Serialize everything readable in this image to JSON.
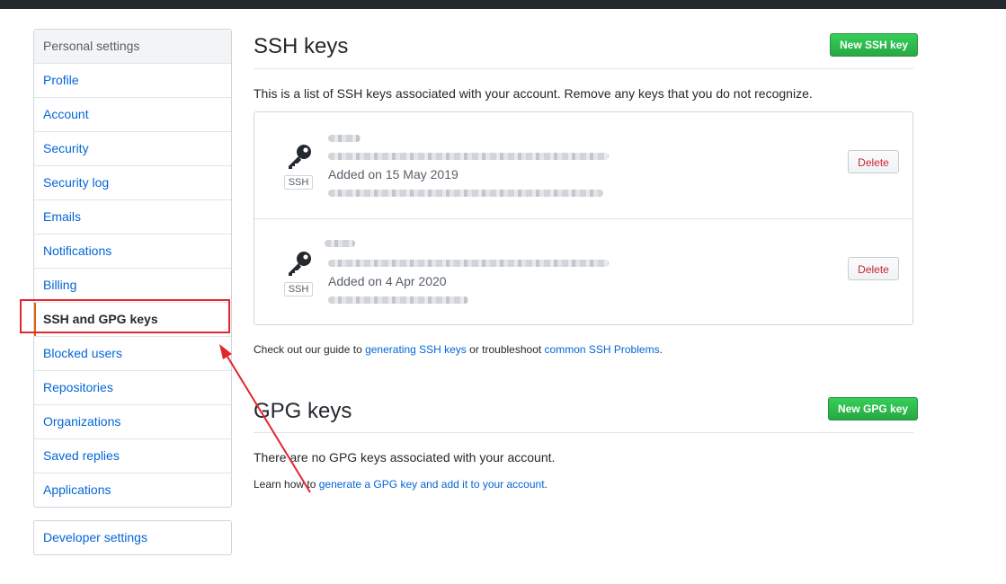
{
  "sidebar": {
    "heading": "Personal settings",
    "items": [
      {
        "label": "Profile"
      },
      {
        "label": "Account"
      },
      {
        "label": "Security"
      },
      {
        "label": "Security log"
      },
      {
        "label": "Emails"
      },
      {
        "label": "Notifications"
      },
      {
        "label": "Billing"
      },
      {
        "label": "SSH and GPG keys",
        "selected": true
      },
      {
        "label": "Blocked users"
      },
      {
        "label": "Repositories"
      },
      {
        "label": "Organizations"
      },
      {
        "label": "Saved replies"
      },
      {
        "label": "Applications"
      }
    ],
    "developer_settings": "Developer settings"
  },
  "ssh": {
    "title": "SSH keys",
    "new_button": "New SSH key",
    "description": "This is a list of SSH keys associated with your account. Remove any keys that you do not recognize.",
    "keys": [
      {
        "type_label": "SSH",
        "added": "Added on 15 May 2019",
        "delete_label": "Delete"
      },
      {
        "type_label": "SSH",
        "added": "Added on 4 Apr 2020",
        "delete_label": "Delete"
      }
    ],
    "help": {
      "prefix": "Check out our guide to ",
      "link1": "generating SSH keys",
      "middle": " or troubleshoot ",
      "link2": "common SSH Problems",
      "suffix": "."
    }
  },
  "gpg": {
    "title": "GPG keys",
    "new_button": "New GPG key",
    "empty_text": "There are no GPG keys associated with your account.",
    "help": {
      "prefix": "Learn how to ",
      "link": "generate a GPG key and add it to your account",
      "suffix": "."
    }
  },
  "colors": {
    "accent_link": "#0366d6",
    "primary_button": "#28a745",
    "danger": "#cb2431",
    "selected_marker": "#e36209",
    "annotation": "#e3262d"
  },
  "icons": [
    "key-icon"
  ]
}
